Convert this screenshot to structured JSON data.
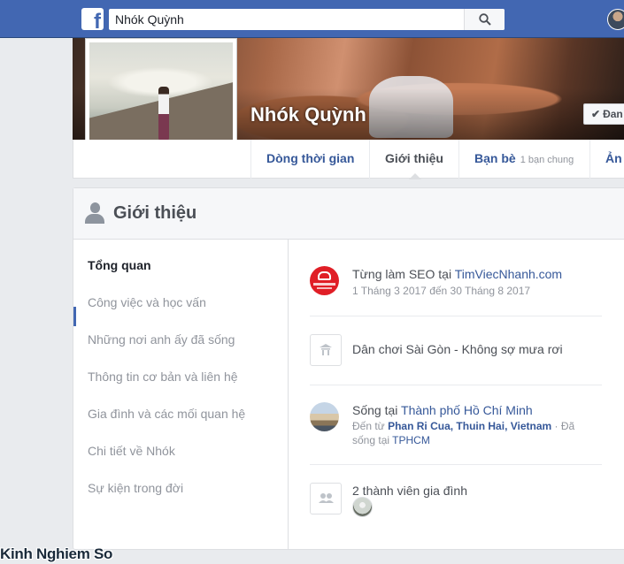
{
  "topbar": {
    "search_value": "Nhók Quỳnh",
    "colors": {
      "bar": "#4267b2"
    }
  },
  "profile": {
    "name": "Nhók Quỳnh",
    "friend_button": "Đan"
  },
  "tabs": [
    {
      "label": "Dòng thời gian",
      "sub": ""
    },
    {
      "label": "Giới thiệu",
      "sub": ""
    },
    {
      "label": "Bạn bè",
      "sub": "1 bạn chung"
    },
    {
      "label": "Ản",
      "sub": ""
    }
  ],
  "intro": {
    "title": "Giới thiệu",
    "nav": [
      "Tổng quan",
      "Công việc và học vấn",
      "Những nơi anh ấy đã sống",
      "Thông tin cơ bản và liên hệ",
      "Gia đình và các mối quan hệ",
      "Chi tiết về Nhók",
      "Sự kiện trong đời"
    ],
    "work": {
      "prefix": "Từng làm SEO tại ",
      "company": "TimViecNhanh.com",
      "dates": "1 Tháng 3 2017 đến 30 Tháng 8 2017"
    },
    "hometown_note": "Dân chơi Sài Gòn - Không sợ mưa rơi",
    "lives": {
      "prefix": "Sống tại ",
      "city": "Thành phố Hồ Chí Minh",
      "from_prefix": "Đến từ ",
      "from": "Phan Ri Cua, Thuin Hai, Vietnam",
      "lived_sep": " · Đã sống tại ",
      "lived": "TPHCM"
    },
    "family": "2 thành viên gia đình"
  },
  "watermark": "Kinh Nghiem So"
}
